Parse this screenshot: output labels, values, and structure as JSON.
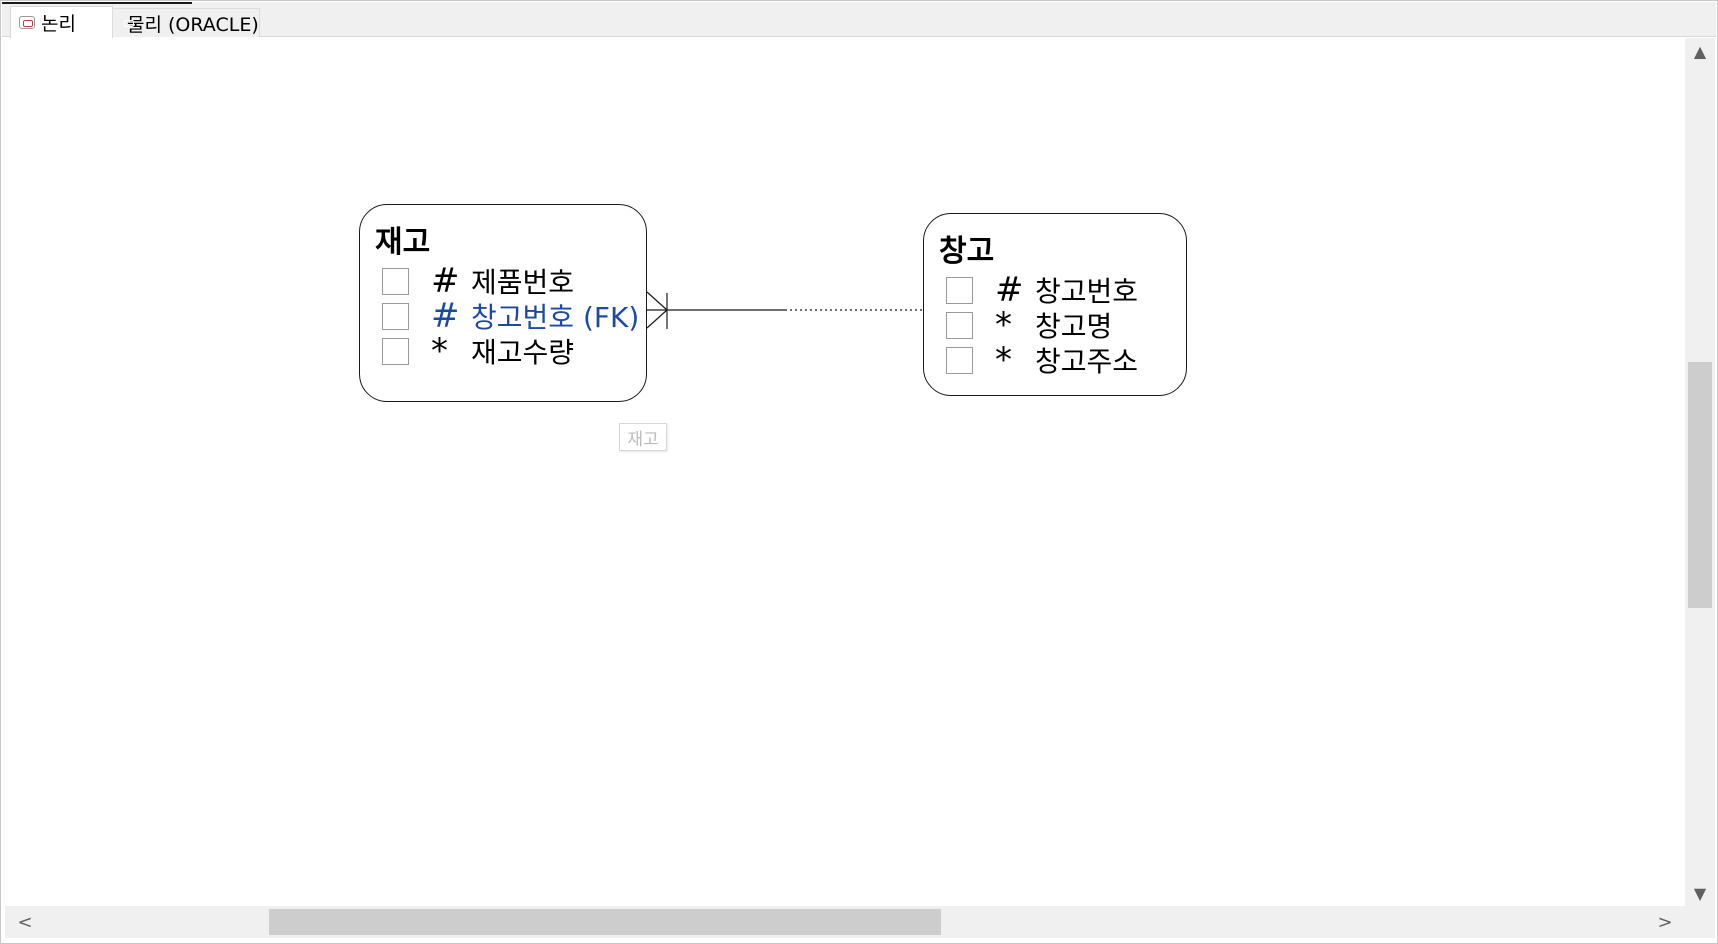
{
  "tabs": [
    {
      "label": "논리",
      "icon": "logical-model-icon",
      "active": true
    },
    {
      "label": "물리 (ORACLE)",
      "icon": "physical-model-icon",
      "active": false
    }
  ],
  "entities": [
    {
      "title": "재고",
      "attributes": [
        {
          "mark": "#",
          "name": "제품번호"
        },
        {
          "mark": "#",
          "name": "창고번호 (FK)",
          "foreign_key": true
        },
        {
          "mark": "*",
          "name": "재고수량"
        }
      ]
    },
    {
      "title": "창고",
      "attributes": [
        {
          "mark": "#",
          "name": "창고번호"
        },
        {
          "mark": "*",
          "name": "창고명"
        },
        {
          "mark": "*",
          "name": "창고주소"
        }
      ]
    }
  ],
  "relationship": {
    "label": "재고"
  },
  "scroll": {
    "left_arrow": "<",
    "right_arrow": ">",
    "up_arrow": "^",
    "down_arrow": "v"
  },
  "colors": {
    "fk_attribute": "#1c4a9e",
    "physical_tab_icon": "#d21e1e"
  }
}
